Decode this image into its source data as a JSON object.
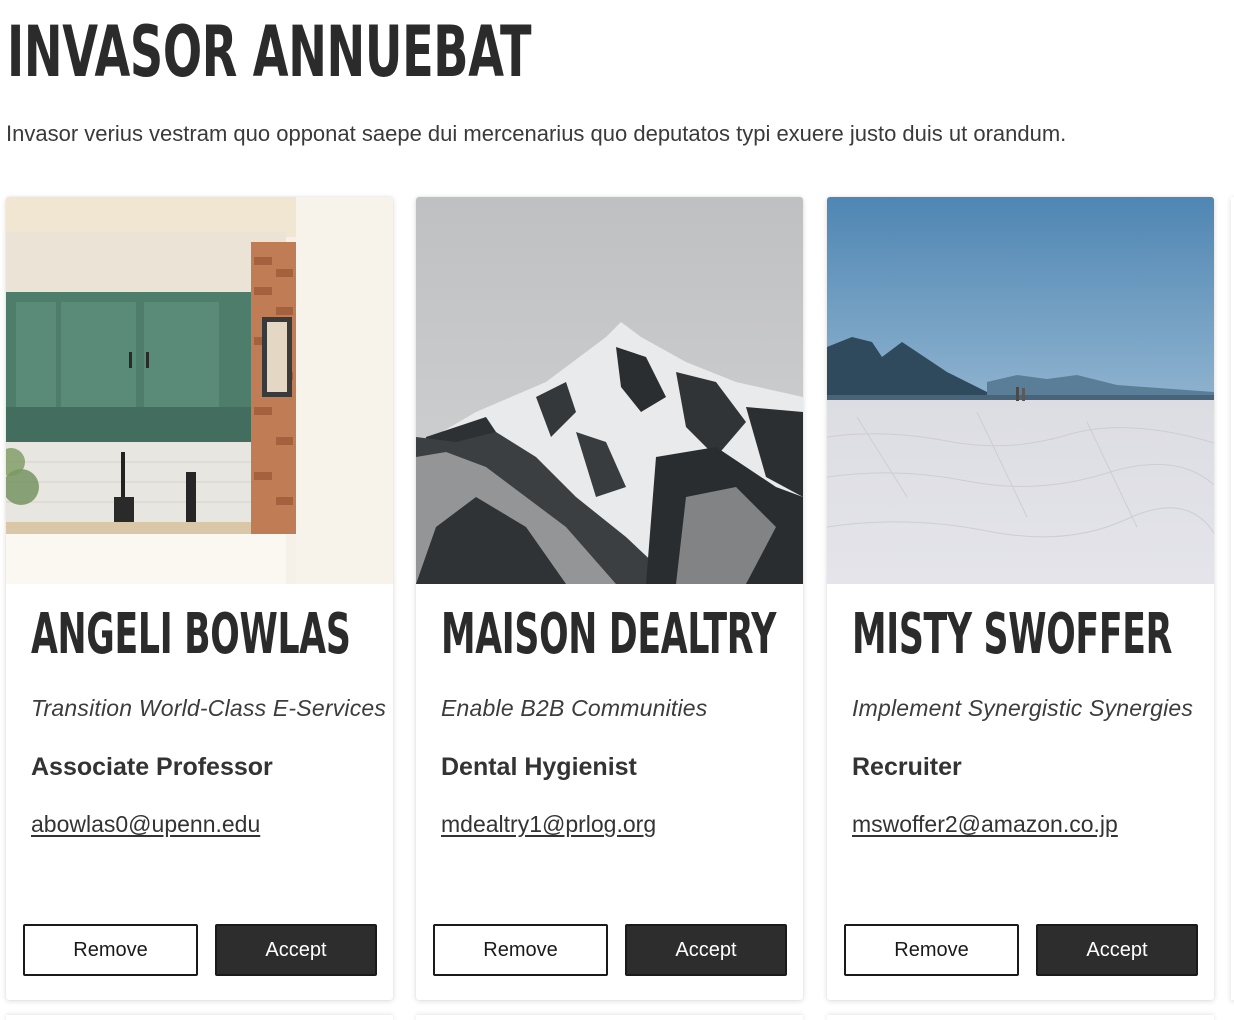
{
  "header": {
    "title": "Invasor Annuebat",
    "description": "Invasor verius vestram quo opponat saepe dui mercenarius quo deputatos typi exuere justo duis ut orandum."
  },
  "cards": [
    {
      "image_subject": "kitchen-photo",
      "name": "Angeli Bowlas",
      "slogan": "Transition World-Class E-Services",
      "role": "Associate Professor",
      "email": "abowlas0@upenn.edu",
      "remove_label": "Remove",
      "accept_label": "Accept"
    },
    {
      "image_subject": "snowy-mountain-photo",
      "name": "Maison Dealtry",
      "slogan": "Enable B2B Communities",
      "role": "Dental Hygienist",
      "email": "mdealtry1@prlog.org",
      "remove_label": "Remove",
      "accept_label": "Accept"
    },
    {
      "image_subject": "salt-flat-photo",
      "name": "Misty Swoffer",
      "slogan": "Implement Synergistic Synergies",
      "role": "Recruiter",
      "email": "mswoffer2@amazon.co.jp",
      "remove_label": "Remove",
      "accept_label": "Accept"
    }
  ],
  "colors": {
    "text": "#333333",
    "title": "#2b2b2b",
    "accept_bg": "#2d2d2d",
    "accept_text": "#ffffff",
    "remove_bg": "#ffffff",
    "border": "#1a1a1a"
  }
}
